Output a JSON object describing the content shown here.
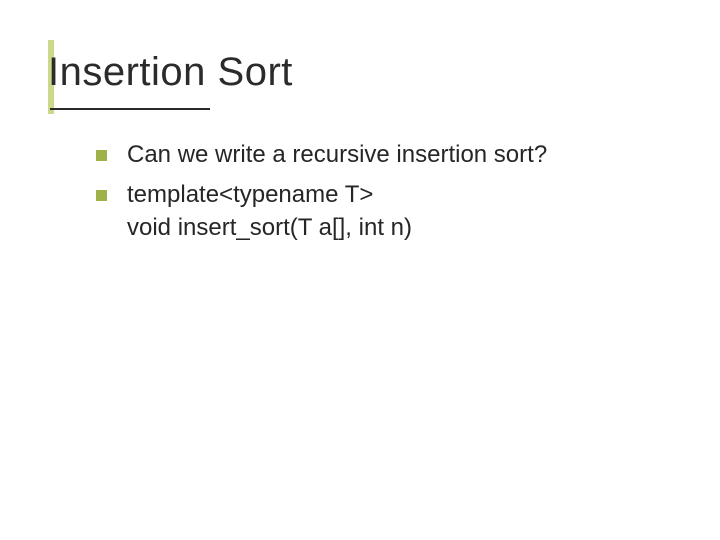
{
  "slide": {
    "title": "Insertion Sort",
    "bullets": [
      {
        "lines": [
          "Can we write a recursive insertion sort?"
        ]
      },
      {
        "lines": [
          "template<typename T>",
          "void insert_sort(T a[], int n)"
        ]
      }
    ]
  }
}
